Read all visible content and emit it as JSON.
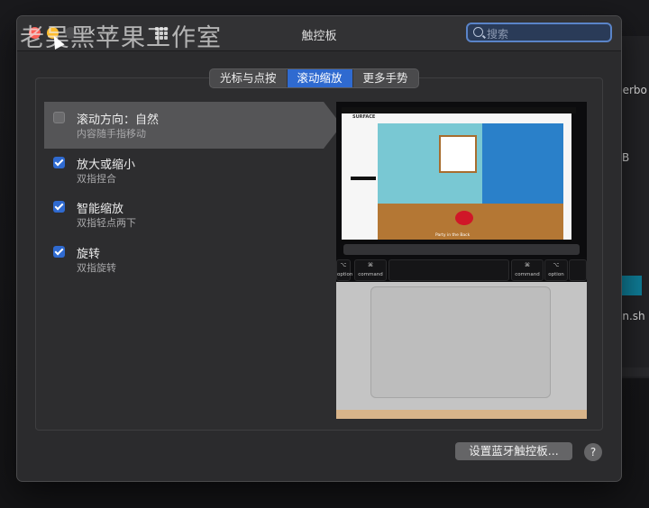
{
  "window": {
    "title": "触控板"
  },
  "search": {
    "placeholder": "搜索"
  },
  "watermark": "老吴黑苹果工作室",
  "tabs": [
    {
      "label": "光标与点按",
      "active": false
    },
    {
      "label": "滚动缩放",
      "active": true
    },
    {
      "label": "更多手势",
      "active": false
    }
  ],
  "options": [
    {
      "title": "滚动方向：自然",
      "subtitle": "内容随手指移动",
      "checked": false,
      "selected": true
    },
    {
      "title": "放大或缩小",
      "subtitle": "双指捏合",
      "checked": true,
      "selected": false
    },
    {
      "title": "智能缩放",
      "subtitle": "双指轻点两下",
      "checked": true,
      "selected": false
    },
    {
      "title": "旋转",
      "subtitle": "双指旋转",
      "checked": true,
      "selected": false
    }
  ],
  "preview": {
    "page_title": "SURFACE",
    "caption": "Party in the Back",
    "keys": [
      {
        "symbol": "⌥",
        "label": "option"
      },
      {
        "symbol": "⌘",
        "label": "command"
      },
      {
        "symbol": "⌘",
        "label": "command"
      },
      {
        "symbol": "⌥",
        "label": "option"
      }
    ]
  },
  "footer": {
    "bluetooth_button": "设置蓝牙触控板...",
    "help_button": "?"
  },
  "background": {
    "snippets": [
      "derbo",
      "B",
      "en.sh"
    ]
  },
  "colors": {
    "accent": "#2f6ad0",
    "window_bg": "#2b2b2d",
    "close": "#fc5f57",
    "minimize": "#fdbc2e"
  }
}
